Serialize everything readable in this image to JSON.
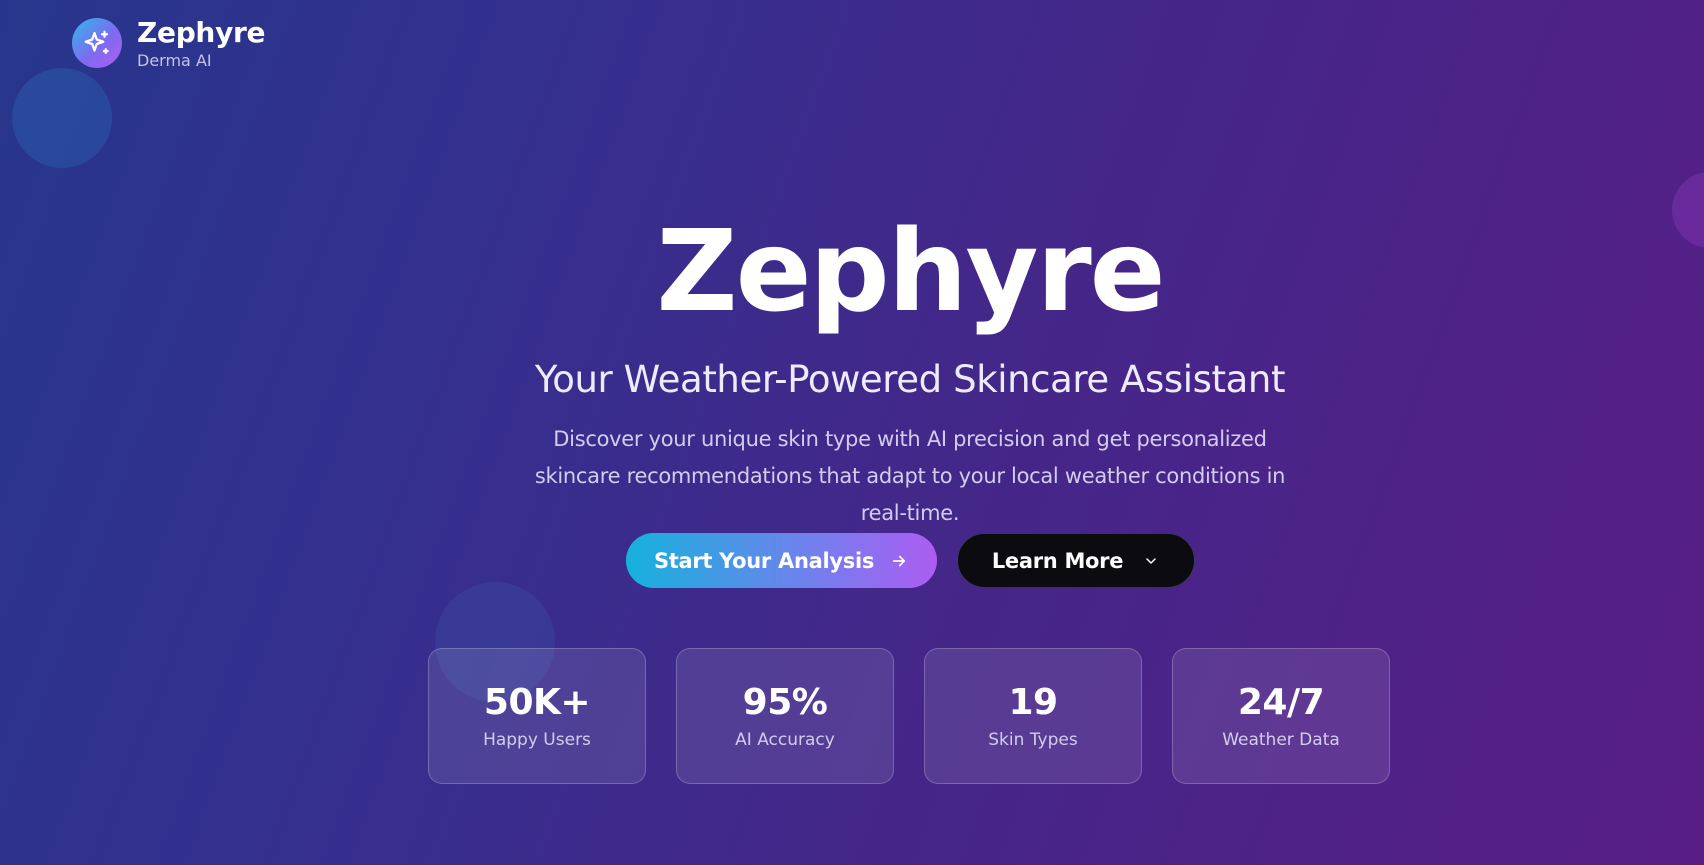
{
  "brand": {
    "name": "Zephyre",
    "subtitle": "Derma AI",
    "logo_icon": "sparkles-icon"
  },
  "hero": {
    "title": "Zephyre",
    "subtitle": "Your Weather-Powered Skincare Assistant",
    "description": "Discover your unique skin type with AI precision and get personalized skincare recommendations that adapt to your local weather conditions in real-time."
  },
  "actions": {
    "primary_label": "Start Your Analysis",
    "primary_icon": "arrow-right-icon",
    "secondary_label": "Learn More",
    "secondary_icon": "chevron-down-icon"
  },
  "stats": [
    {
      "value": "50K+",
      "label": "Happy Users"
    },
    {
      "value": "95%",
      "label": "AI Accuracy"
    },
    {
      "value": "19",
      "label": "Skin Types"
    },
    {
      "value": "24/7",
      "label": "Weather Data"
    }
  ],
  "colors": {
    "background_start": "#27368c",
    "background_end": "#581e86",
    "primary_gradient_start": "#15b2dc",
    "primary_gradient_end": "#ad5cf2",
    "secondary_button": "#0b0b10"
  }
}
